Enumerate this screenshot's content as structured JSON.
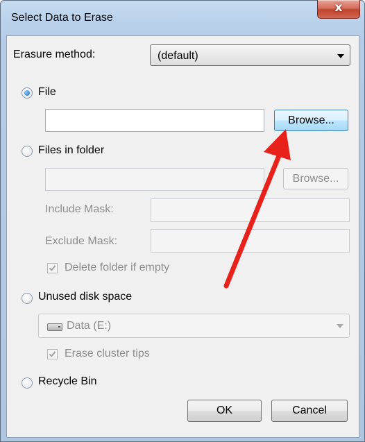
{
  "window": {
    "title": "Select Data to Erase",
    "close_glyph": "x"
  },
  "erasure": {
    "label": "Erasure method:",
    "value": "(default)"
  },
  "file_option": {
    "label": "File",
    "path_value": "",
    "browse_label": "Browse..."
  },
  "folder_option": {
    "label": "Files in folder",
    "path_value": "",
    "browse_label": "Browse...",
    "include_label": "Include Mask:",
    "exclude_label": "Exclude Mask:",
    "delete_empty_label": "Delete folder if empty"
  },
  "unused_option": {
    "label": "Unused disk space",
    "drive_value": "Data (E:)",
    "drive_icon": "drive-icon",
    "cluster_tips_label": "Erase cluster tips"
  },
  "recycle_option": {
    "label": "Recycle Bin"
  },
  "buttons": {
    "ok": "OK",
    "cancel": "Cancel"
  },
  "annotation": {
    "arrow_color": "#e8211b"
  }
}
